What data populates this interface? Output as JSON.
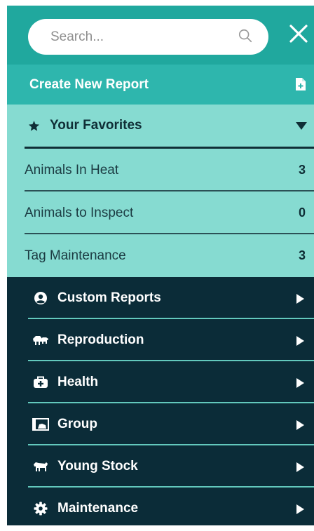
{
  "search": {
    "placeholder": "Search..."
  },
  "create_report": {
    "label": "Create New Report"
  },
  "favorites": {
    "title": "Your Favorites",
    "items": [
      {
        "label": "Animals In Heat",
        "count": "3"
      },
      {
        "label": "Animals to Inspect",
        "count": "0"
      },
      {
        "label": "Tag Maintenance",
        "count": "3"
      }
    ]
  },
  "menu": {
    "items": [
      {
        "label": "Custom Reports",
        "icon": "user-circle-icon"
      },
      {
        "label": "Reproduction",
        "icon": "cow-pair-icon"
      },
      {
        "label": "Health",
        "icon": "medical-kit-icon"
      },
      {
        "label": "Group",
        "icon": "group-folder-icon"
      },
      {
        "label": "Young Stock",
        "icon": "calf-icon"
      },
      {
        "label": "Maintenance",
        "icon": "gear-icon"
      }
    ]
  },
  "colors": {
    "header_teal": "#20a89e",
    "create_teal": "#2eb6ad",
    "favorites_bg": "#86dbd1",
    "menu_dark": "#0b2c38",
    "divider_light": "#63c9bd"
  }
}
